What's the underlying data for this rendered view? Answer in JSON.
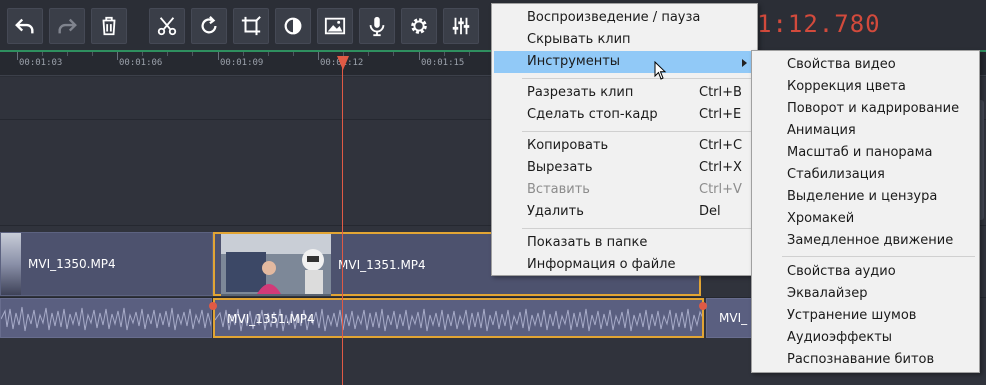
{
  "toolbar": {
    "buttons": [
      {
        "icon": "undo-icon"
      },
      {
        "icon": "redo-icon"
      },
      {
        "icon": "trash-icon"
      },
      {
        "icon": "scissors-icon"
      },
      {
        "icon": "rotate-icon"
      },
      {
        "icon": "crop-icon"
      },
      {
        "icon": "color-icon"
      },
      {
        "icon": "image-icon"
      },
      {
        "icon": "microphone-icon"
      },
      {
        "icon": "gear-icon"
      },
      {
        "icon": "equalizer-icon"
      }
    ],
    "timecode": "1:12.780"
  },
  "ruler": {
    "ticks": [
      "00:01:03",
      "00:01:06",
      "00:01:09",
      "00:01:12",
      "00:01:15"
    ]
  },
  "clips": {
    "video": [
      {
        "name": "MVI_1350.MP4"
      },
      {
        "name": "MVI_1351.MP4"
      }
    ],
    "audio": [
      {
        "name": "MVI_1351.MP4"
      },
      {
        "name": "MVI_"
      }
    ]
  },
  "context_menu": {
    "items": [
      {
        "label": "Воспроизведение / пауза",
        "shortcut": ""
      },
      {
        "label": "Скрывать клип",
        "shortcut": ""
      },
      {
        "label": "Инструменты",
        "shortcut": ""
      },
      {
        "label": "Разрезать клип",
        "shortcut": "Ctrl+B"
      },
      {
        "label": "Сделать стоп-кадр",
        "shortcut": "Ctrl+E"
      },
      {
        "label": "Копировать",
        "shortcut": "Ctrl+C"
      },
      {
        "label": "Вырезать",
        "shortcut": "Ctrl+X"
      },
      {
        "label": "Вставить",
        "shortcut": "Ctrl+V"
      },
      {
        "label": "Удалить",
        "shortcut": "Del"
      },
      {
        "label": "Показать в папке",
        "shortcut": ""
      },
      {
        "label": "Информация о файле",
        "shortcut": ""
      }
    ]
  },
  "submenu": {
    "items": [
      "Свойства видео",
      "Коррекция цвета",
      "Поворот и кадрирование",
      "Анимация",
      "Масштаб и панорама",
      "Стабилизация",
      "Выделение и цензура",
      "Хромакей",
      "Замедленное движение",
      "Свойства аудио",
      "Эквалайзер",
      "Устранение шумов",
      "Аудиоэффекты",
      "Распознавание битов"
    ]
  },
  "colors": {
    "accent_selection": "#e2a534",
    "playhead": "#e05a45",
    "menu_highlight": "#91c9f7",
    "timecode": "#d24a3c"
  }
}
